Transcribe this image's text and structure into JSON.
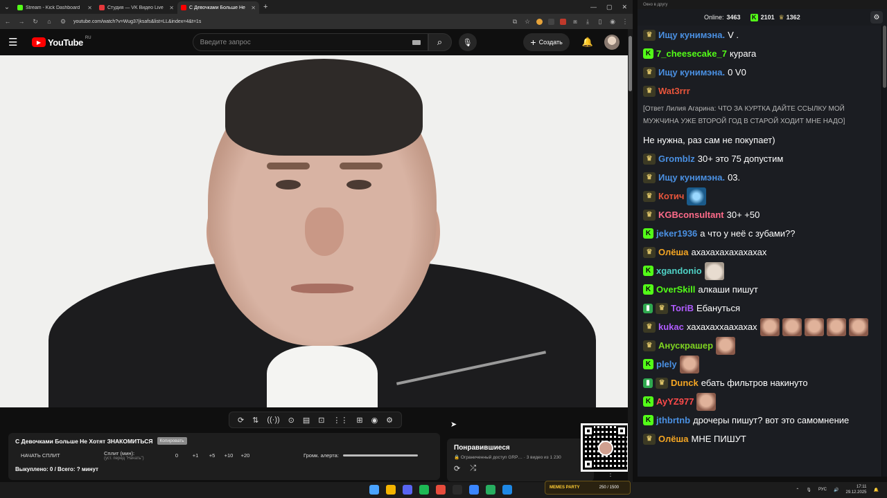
{
  "browser": {
    "tabs": [
      {
        "title": "Stream - Kick Dashboard",
        "color": "#53fc18",
        "active": false
      },
      {
        "title": "Студия — VK Видео Live",
        "color": "#e5383b",
        "active": false
      },
      {
        "title": "С Девочками Больше Не",
        "color": "#ff0000",
        "active": true
      }
    ],
    "url": "youtube.com/watch?v=Wug37jksafs&list=LL&index=4&t=1s",
    "ext_badge": "136"
  },
  "youtube": {
    "logo_text": "YouTube",
    "country": "RU",
    "search_placeholder": "Введите запрос",
    "create_label": "Создать"
  },
  "player_tools": [
    "⟳",
    "⇅",
    "((·))",
    "⊙",
    "▤",
    "⊡",
    "⋮⋮",
    "⊞",
    "◉",
    "⚙"
  ],
  "split_panel": {
    "title": "С Девочками Больше Не Хотят ЗНАКОМИТЬСЯ",
    "badge": "Копировать",
    "start_label": "НАЧАТЬ СПЛИТ",
    "split_label": "Сплит (мин):",
    "split_hint": "(уст. перед \"Начать\")",
    "split_value": "0",
    "increments": [
      "+1",
      "+5",
      "+10",
      "+20"
    ],
    "volume_label": "Громк. алерта:",
    "bought_text": "Выкуплено: 0 / Всего: ? минут"
  },
  "liked_panel": {
    "title": "Понравившиеся",
    "subtitle": "Ограниченный доступ GRP… · 3 видео из 1 230"
  },
  "chat_window": {
    "title": "Окно в другу",
    "online_label": "Online:",
    "online_count": "3463",
    "kick_count": "2101",
    "other_count": "1362"
  },
  "chat": [
    {
      "icons": [
        "y"
      ],
      "user": "Ищу кунимэна.",
      "color": "#4a90e2",
      "text": "V ."
    },
    {
      "icons": [
        "k"
      ],
      "user": "7_cheesecake_7",
      "color": "#53fc18",
      "text": "курага"
    },
    {
      "icons": [
        "y"
      ],
      "user": "Ищу кунимэна.",
      "color": "#4a90e2",
      "text": "0  V0"
    },
    {
      "icons": [
        "y"
      ],
      "user": "Wat3rrr",
      "color": "#e8553b",
      "reply": "[Ответ Лилия Агарина: ЧТО ЗА КУРТКА ДАЙТЕ ССЫЛКУ МОЙ МУЖЧИНА УЖЕ ВТОРОЙ ГОД В СТАРОЙ ХОДИТ МНЕ НАДО]",
      "text": "Не нужна, раз сам не покупает)"
    },
    {
      "icons": [
        "y"
      ],
      "user": "Gromblz",
      "color": "#4a90e2",
      "text": "30+ это 75 допустим"
    },
    {
      "icons": [
        "y"
      ],
      "user": "Ищу кунимэна.",
      "color": "#4a90e2",
      "text": "03."
    },
    {
      "icons": [
        "y"
      ],
      "user": "Котич",
      "color": "#e8553b",
      "text": "",
      "emotes": [
        "blue"
      ]
    },
    {
      "icons": [
        "y"
      ],
      "user": "KGBconsultant",
      "color": "#ff6b8a",
      "text": "30+ +50"
    },
    {
      "icons": [
        "k"
      ],
      "user": "jeker1936",
      "color": "#4a90e2",
      "text": "а что у неё с зубами??"
    },
    {
      "icons": [
        "y"
      ],
      "user": "Олёша",
      "color": "#f5a623",
      "text": "ахахахахахахахах"
    },
    {
      "icons": [
        "k"
      ],
      "user": "xgandonio",
      "color": "#4fd1c5",
      "text": "",
      "emotes": [
        "cat"
      ]
    },
    {
      "icons": [
        "k"
      ],
      "user": "OverSkill",
      "color": "#53fc18",
      "text": "алкаши пишут"
    },
    {
      "icons": [
        "s",
        "y"
      ],
      "user": "ToriB",
      "color": "#b05cff",
      "text": "Ебануться"
    },
    {
      "icons": [
        "y"
      ],
      "user": "kukac",
      "color": "#b05cff",
      "text": "хахахаххаахахах",
      "emotes": [
        "face",
        "face",
        "face",
        "face",
        "face"
      ]
    },
    {
      "icons": [
        "y"
      ],
      "user": "Анускрашер",
      "color": "#7ed321",
      "text": "",
      "emotes": [
        "face"
      ]
    },
    {
      "icons": [
        "k"
      ],
      "user": "plely",
      "color": "#4a90e2",
      "text": "",
      "emotes": [
        "face"
      ]
    },
    {
      "icons": [
        "s",
        "y"
      ],
      "user": "Dunck",
      "color": "#f5a623",
      "text": "ебать фильтров накинуто"
    },
    {
      "icons": [
        "k"
      ],
      "user": "AyYZ977",
      "color": "#ff4a4a",
      "text": "",
      "emotes": [
        "face"
      ]
    },
    {
      "icons": [
        "k"
      ],
      "user": "jthbrtnb",
      "color": "#4a90e2",
      "text": "дрочеры пишут? вот это самомнение"
    },
    {
      "icons": [
        "y"
      ],
      "user": "Олёша",
      "color": "#f5a623",
      "text": "МНЕ ПИШУТ"
    }
  ],
  "taskbar": {
    "memes_label": "MEMES PARTY",
    "memes_count": "250 / 1500",
    "lang": "РУС",
    "time": "17:11",
    "date": "29.12.2025"
  }
}
